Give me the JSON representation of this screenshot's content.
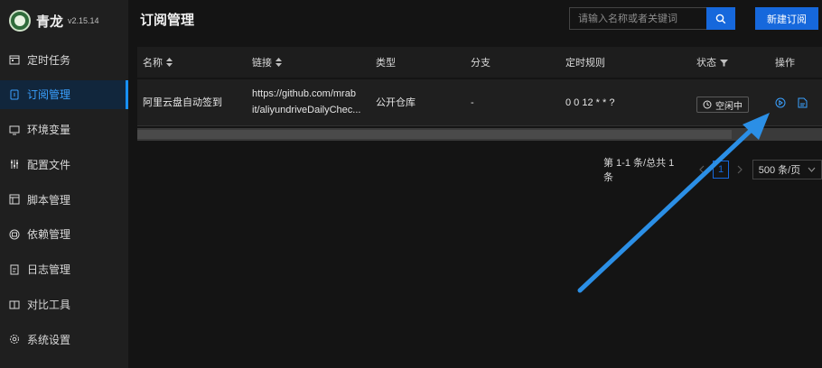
{
  "brand": {
    "name": "青龙",
    "version": "v2.15.14"
  },
  "sidebar": {
    "items": [
      {
        "label": "定时任务",
        "icon": "calendar-icon",
        "active": false
      },
      {
        "label": "订阅管理",
        "icon": "subscription-icon",
        "active": true
      },
      {
        "label": "环境变量",
        "icon": "monitor-icon",
        "active": false
      },
      {
        "label": "配置文件",
        "icon": "sliders-icon",
        "active": false
      },
      {
        "label": "脚本管理",
        "icon": "script-icon",
        "active": false
      },
      {
        "label": "依赖管理",
        "icon": "package-icon",
        "active": false
      },
      {
        "label": "日志管理",
        "icon": "log-icon",
        "active": false
      },
      {
        "label": "对比工具",
        "icon": "diff-icon",
        "active": false
      },
      {
        "label": "系统设置",
        "icon": "gear-icon",
        "active": false
      }
    ]
  },
  "header": {
    "title": "订阅管理",
    "search_placeholder": "请输入名称或者关键词",
    "new_button": "新建订阅"
  },
  "table": {
    "columns": [
      "名称",
      "链接",
      "类型",
      "分支",
      "定时规则",
      "状态",
      "操作"
    ],
    "rows": [
      {
        "name": "阿里云盘自动签到",
        "link_line1": "https://github.com/mrab",
        "link_line2": "it/aliyundriveDailyChec...",
        "type": "公开仓库",
        "branch": "-",
        "schedule": "0 0 12 * * ?",
        "status": "空闲中"
      }
    ]
  },
  "pagination": {
    "summary": "第 1-1 条/总共 1 条",
    "current_page": "1",
    "page_size": "500 条/页"
  },
  "colors": {
    "accent": "#1668dc",
    "arrow": "#2b8fe6"
  }
}
